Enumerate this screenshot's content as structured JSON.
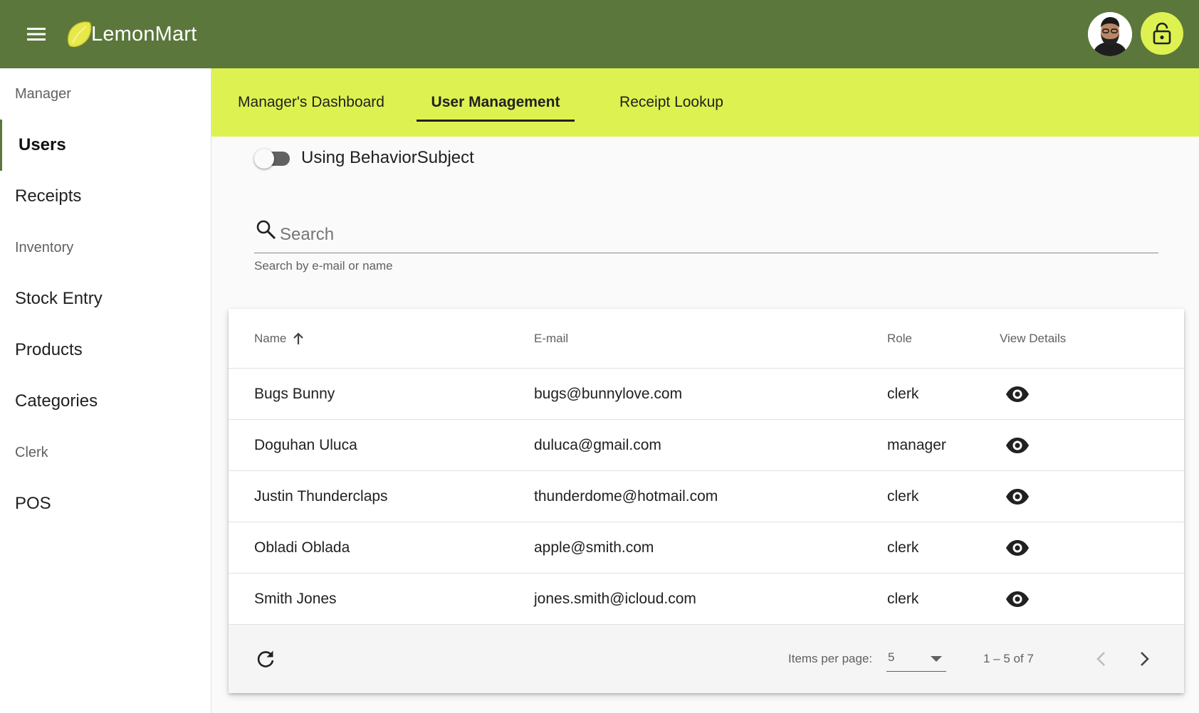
{
  "app": {
    "title": "LemonMart",
    "brand_color": "#5b773c",
    "accent_color": "#ddf250"
  },
  "toolbar": {
    "menu_icon": "menu-icon",
    "avatar_icon": "user-avatar",
    "lock_icon": "lock-open-icon"
  },
  "sidebar": {
    "items": [
      {
        "label": "Manager",
        "type": "header"
      },
      {
        "label": "Users",
        "type": "link",
        "active": true
      },
      {
        "label": "Receipts",
        "type": "link"
      },
      {
        "label": "Inventory",
        "type": "header"
      },
      {
        "label": "Stock Entry",
        "type": "link"
      },
      {
        "label": "Products",
        "type": "link"
      },
      {
        "label": "Categories",
        "type": "link"
      },
      {
        "label": "Clerk",
        "type": "header"
      },
      {
        "label": "POS",
        "type": "link"
      }
    ]
  },
  "tabs": [
    {
      "label": "Manager's Dashboard",
      "active": false
    },
    {
      "label": "User Management",
      "active": true
    },
    {
      "label": "Receipt Lookup",
      "active": false
    }
  ],
  "toggle": {
    "label": "Using BehaviorSubject",
    "checked": false
  },
  "search": {
    "placeholder": "Search",
    "value": "",
    "hint": "Search by e-mail or name"
  },
  "table": {
    "columns": [
      "Name",
      "E-mail",
      "Role",
      "View Details"
    ],
    "sort_column": "Name",
    "sort_direction": "asc",
    "rows": [
      {
        "name": "Bugs Bunny",
        "email": "bugs@bunnylove.com",
        "role": "clerk"
      },
      {
        "name": "Doguhan Uluca",
        "email": "duluca@gmail.com",
        "role": "manager"
      },
      {
        "name": "Justin Thunderclaps",
        "email": "thunderdome@hotmail.com",
        "role": "clerk"
      },
      {
        "name": "Obladi Oblada",
        "email": "apple@smith.com",
        "role": "clerk"
      },
      {
        "name": "Smith Jones",
        "email": "jones.smith@icloud.com",
        "role": "clerk"
      }
    ]
  },
  "paginator": {
    "items_per_page_label": "Items per page:",
    "items_per_page": "5",
    "range_label": "1 – 5 of 7"
  }
}
